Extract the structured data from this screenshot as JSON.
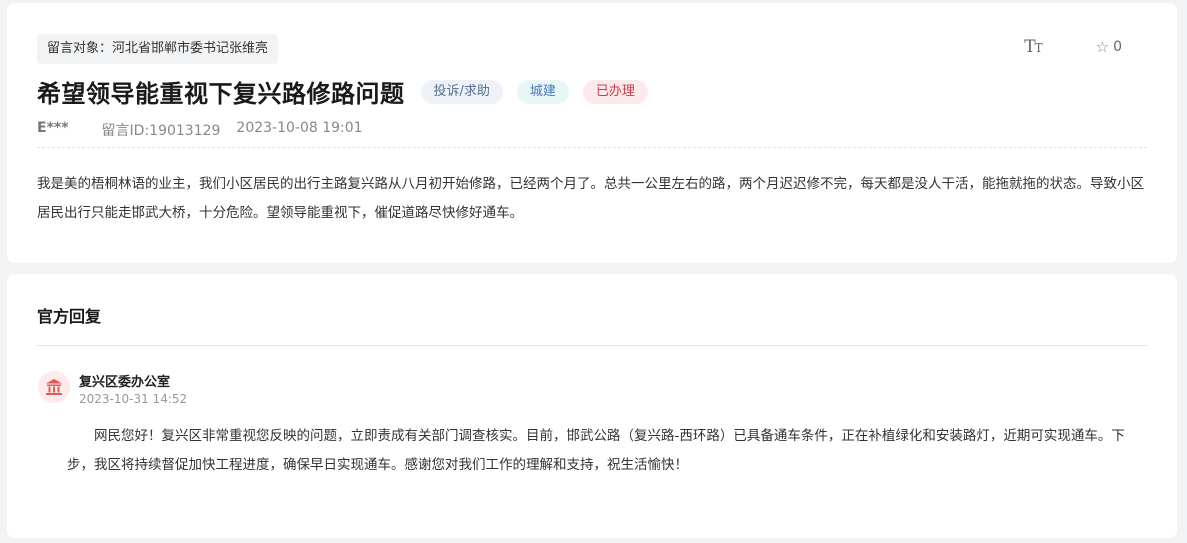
{
  "message": {
    "target_label": "留言对象：河北省邯郸市委书记张维亮",
    "title": "希望领导能重视下复兴路修路问题",
    "tags": {
      "type": "投诉/求助",
      "category": "城建",
      "status": "已办理"
    },
    "author": "E***",
    "message_id": "留言ID:19013129",
    "date": "2023-10-08 19:01",
    "content": "我是美的梧桐林语的业主，我们小区居民的出行主路复兴路从八月初开始修路，已经两个月了。总共一公里左右的路，两个月迟迟修不完，每天都是没人干活，能拖就拖的状态。导致小区居民出行只能走邯武大桥，十分危险。望领导能重视下，催促道路尽快修好通车。"
  },
  "tools": {
    "font_icon": "font-size-icon",
    "favorite_icon": "star-icon",
    "favorite_count": "0"
  },
  "reply": {
    "section_title": "官方回复",
    "avatar_icon": "government-building-icon",
    "department": "复兴区委办公室",
    "time": "2023-10-31 14:52",
    "content": "网民您好！复兴区非常重视您反映的问题，立即责成有关部门调查核实。目前，邯武公路（复兴路-西环路）已具备通车条件，正在补植绿化和安装路灯，近期可实现通车。下步，我区将持续督促加快工程进度，确保早日实现通车。感谢您对我们工作的理解和支持，祝生活愉快！"
  },
  "colors": {
    "status_red": "#d23a4a",
    "category_blue": "#4a78b8",
    "type_gray_blue": "#5a6f94",
    "avatar_red": "#e05a5a"
  }
}
